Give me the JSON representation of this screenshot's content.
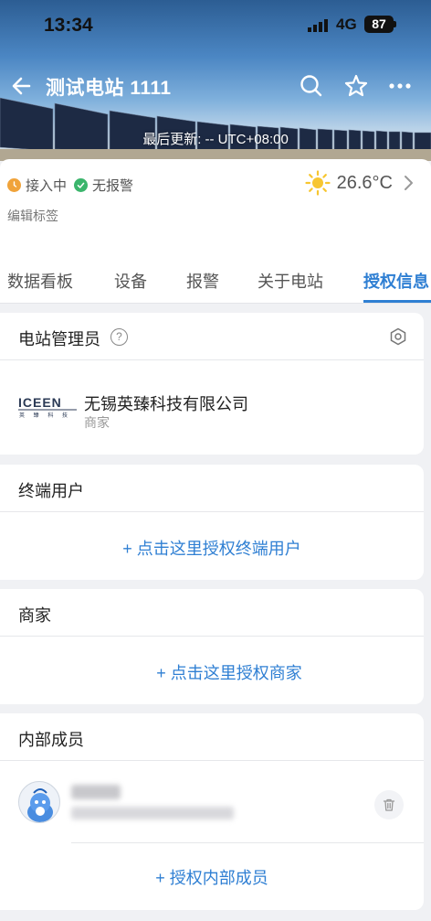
{
  "status_bar": {
    "time": "13:34",
    "network": "4G",
    "battery": "87"
  },
  "header": {
    "title": "测试电站 1111",
    "last_update": "最后更新: -- UTC+08:00",
    "icons": [
      "back-arrow-icon",
      "search-icon",
      "star-icon",
      "more-icon"
    ]
  },
  "station_info": {
    "status_connecting": "接入中",
    "status_alarm": "无报警",
    "temperature": "26.6°C",
    "weather_icon": "sun-icon",
    "edit_tags": "编辑标签"
  },
  "tabs": [
    {
      "label": "数据看板",
      "active": false
    },
    {
      "label": "设备",
      "active": false
    },
    {
      "label": "报警",
      "active": false
    },
    {
      "label": "关于电站",
      "active": false
    },
    {
      "label": "授权信息",
      "active": true
    }
  ],
  "sections": {
    "admin": {
      "title": "电站管理员",
      "company_logo_text": "ICEEN",
      "company_logo_sub": "英 臻 科 技",
      "company_name": "无锡英臻科技有限公司",
      "company_role": "商家"
    },
    "end_users": {
      "title": "终端用户",
      "action": "+ 点击这里授权终端用户"
    },
    "merchants": {
      "title": "商家",
      "action": "+ 点击这里授权商家"
    },
    "internal": {
      "title": "内部成员",
      "action": "+ 授权内部成员"
    }
  },
  "colors": {
    "accent": "#2f7fd3",
    "status_orange": "#f0a33a",
    "status_green": "#3bb56c"
  }
}
